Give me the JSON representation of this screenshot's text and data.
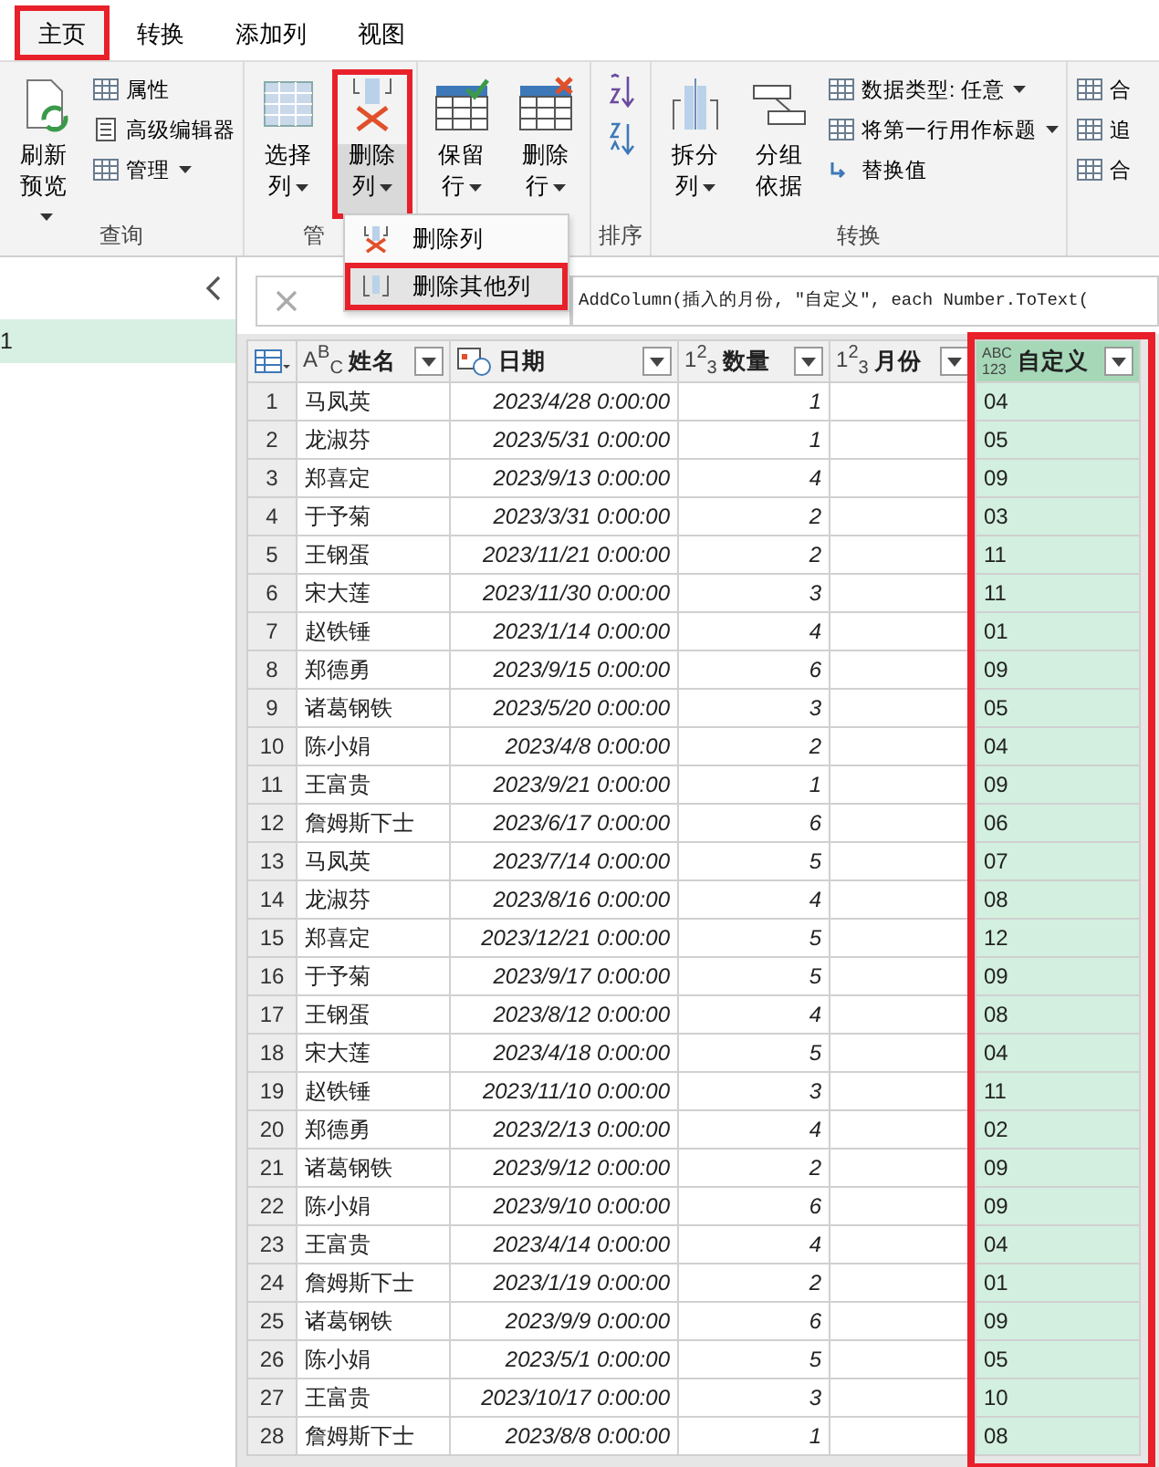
{
  "tabs": [
    {
      "label": "主页",
      "selected": true,
      "annotated": true
    },
    {
      "label": "转换",
      "selected": false,
      "annotated": false
    },
    {
      "label": "添加列",
      "selected": false,
      "annotated": false
    },
    {
      "label": "视图",
      "selected": false,
      "annotated": false
    }
  ],
  "ribbon": {
    "groups": [
      {
        "label": "查询",
        "items": [
          {
            "kind": "large",
            "label": "刷新预览",
            "dropdown": true,
            "annotated": false
          },
          {
            "kind": "small",
            "label": "属性",
            "dropdown": false
          },
          {
            "kind": "small",
            "label": "高级编辑器",
            "dropdown": false
          },
          {
            "kind": "small",
            "label": "管理",
            "dropdown": true
          }
        ]
      },
      {
        "label": "管",
        "items": [
          {
            "kind": "large",
            "label": "选择列",
            "dropdown": true,
            "annotated": false
          },
          {
            "kind": "large",
            "label": "删除列",
            "dropdown": true,
            "annotated": true
          }
        ]
      },
      {
        "items": [
          {
            "kind": "large",
            "label": "保留行",
            "dropdown": true,
            "annotated": false
          },
          {
            "kind": "large",
            "label": "删除行",
            "dropdown": true,
            "annotated": false
          }
        ]
      },
      {
        "label": "排序",
        "items": [
          {
            "kind": "sort"
          }
        ]
      },
      {
        "label": "转换",
        "items": [
          {
            "kind": "large",
            "label": "拆分列",
            "dropdown": true,
            "annotated": false
          },
          {
            "kind": "large",
            "label": "分组依据",
            "dropdown": false,
            "annotated": false
          },
          {
            "kind": "small",
            "label": "数据类型: 任意",
            "dropdown": true
          },
          {
            "kind": "small",
            "label": "将第一行用作标题",
            "dropdown": true
          },
          {
            "kind": "small",
            "label": "替换值",
            "dropdown": false
          }
        ]
      },
      {
        "items": [
          {
            "kind": "small",
            "label": "合"
          },
          {
            "kind": "small",
            "label": "追"
          },
          {
            "kind": "small",
            "label": "合"
          }
        ]
      }
    ]
  },
  "menu": [
    {
      "label": "删除列",
      "selected": false,
      "annotated": false
    },
    {
      "label": "删除其他列",
      "selected": true,
      "annotated": true
    }
  ],
  "queries": [
    {
      "label": "1",
      "selected": true
    }
  ],
  "formula": "AddColumn(插入的月份, \"自定义\", each Number.ToText(",
  "table": {
    "columns": [
      {
        "kind": "number-column"
      },
      {
        "kind": "text",
        "type_label": "A$^{B}$$_{C}$",
        "label": "姓名",
        "selected": false
      },
      {
        "kind": "date",
        "label": "日期",
        "selected": false
      },
      {
        "kind": "number",
        "type_label": "1$^{2}$$_{3}$",
        "label": "数量",
        "selected": false
      },
      {
        "kind": "number",
        "type_label": "1$^{2}$$_{3}$",
        "label": "月份",
        "selected": false
      },
      {
        "kind": "any",
        "type_label": "ABC",
        "type_label_2": "123",
        "label": "自定义",
        "selected": true,
        "annotated": true
      }
    ],
    "rows": [
      [
        "1",
        "马凤英",
        "2023/4/28 0:00:00",
        "1",
        "",
        "04"
      ],
      [
        "2",
        "龙淑芬",
        "2023/5/31 0:00:00",
        "1",
        "",
        "05"
      ],
      [
        "3",
        "郑喜定",
        "2023/9/13 0:00:00",
        "4",
        "",
        "09"
      ],
      [
        "4",
        "于予菊",
        "2023/3/31 0:00:00",
        "2",
        "",
        "03"
      ],
      [
        "5",
        "王钢蛋",
        "2023/11/21 0:00:00",
        "2",
        "",
        "11"
      ],
      [
        "6",
        "宋大莲",
        "2023/11/30 0:00:00",
        "3",
        "",
        "11"
      ],
      [
        "7",
        "赵铁锤",
        "2023/1/14 0:00:00",
        "4",
        "",
        "01"
      ],
      [
        "8",
        "郑德勇",
        "2023/9/15 0:00:00",
        "6",
        "",
        "09"
      ],
      [
        "9",
        "诸葛钢铁",
        "2023/5/20 0:00:00",
        "3",
        "",
        "05"
      ],
      [
        "10",
        "陈小娟",
        "2023/4/8 0:00:00",
        "2",
        "",
        "04"
      ],
      [
        "11",
        "王富贵",
        "2023/9/21 0:00:00",
        "1",
        "",
        "09"
      ],
      [
        "12",
        "詹姆斯下士",
        "2023/6/17 0:00:00",
        "6",
        "",
        "06"
      ],
      [
        "13",
        "马凤英",
        "2023/7/14 0:00:00",
        "5",
        "",
        "07"
      ],
      [
        "14",
        "龙淑芬",
        "2023/8/16 0:00:00",
        "4",
        "",
        "08"
      ],
      [
        "15",
        "郑喜定",
        "2023/12/21 0:00:00",
        "5",
        "",
        "12"
      ],
      [
        "16",
        "于予菊",
        "2023/9/17 0:00:00",
        "5",
        "",
        "09"
      ],
      [
        "17",
        "王钢蛋",
        "2023/8/12 0:00:00",
        "4",
        "",
        "08"
      ],
      [
        "18",
        "宋大莲",
        "2023/4/18 0:00:00",
        "5",
        "",
        "04"
      ],
      [
        "19",
        "赵铁锤",
        "2023/11/10 0:00:00",
        "3",
        "",
        "11"
      ],
      [
        "20",
        "郑德勇",
        "2023/2/13 0:00:00",
        "4",
        "",
        "02"
      ],
      [
        "21",
        "诸葛钢铁",
        "2023/9/12 0:00:00",
        "2",
        "",
        "09"
      ],
      [
        "22",
        "陈小娟",
        "2023/9/10 0:00:00",
        "6",
        "",
        "09"
      ],
      [
        "23",
        "王富贵",
        "2023/4/14 0:00:00",
        "4",
        "",
        "04"
      ],
      [
        "24",
        "詹姆斯下士",
        "2023/1/19 0:00:00",
        "2",
        "",
        "01"
      ],
      [
        "25",
        "诸葛钢铁",
        "2023/9/9 0:00:00",
        "6",
        "",
        "09"
      ],
      [
        "26",
        "陈小娟",
        "2023/5/1 0:00:00",
        "5",
        "",
        "05"
      ],
      [
        "27",
        "王富贵",
        "2023/10/17 0:00:00",
        "3",
        "",
        "10"
      ],
      [
        "28",
        "詹姆斯下士",
        "2023/8/8 0:00:00",
        "1",
        "",
        "08"
      ]
    ]
  }
}
